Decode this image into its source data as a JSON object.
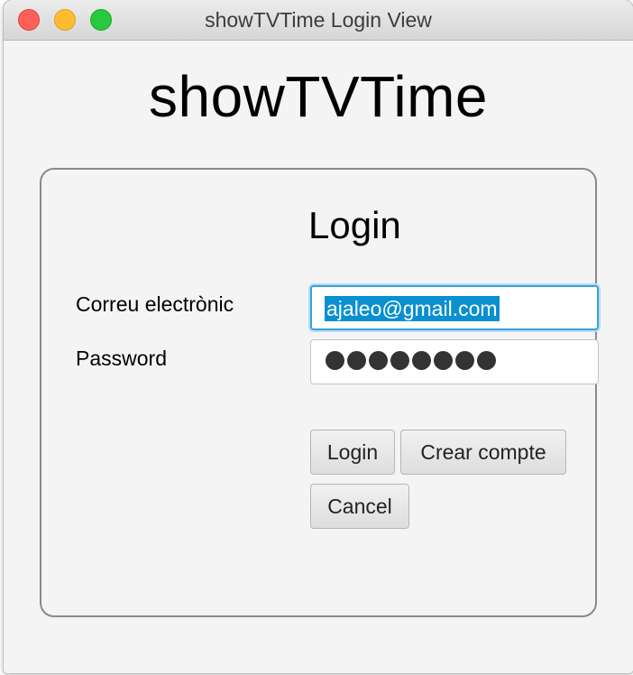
{
  "window": {
    "title": "showTVTime Login View"
  },
  "app": {
    "title": "showTVTime"
  },
  "login_form": {
    "heading": "Login",
    "email_label": "Correu electrònic",
    "email_value": "ajaleo@gmail.com",
    "password_label": "Password",
    "password_mask_count": 8,
    "buttons": {
      "login": "Login",
      "create_account": "Crear compte",
      "cancel": "Cancel"
    }
  },
  "colors": {
    "selection_highlight": "#0a8fd0",
    "focus_ring": "#3aa0dc",
    "close": "#fe5f57",
    "minimize": "#febc2e",
    "maximize": "#28c840"
  },
  "icons": [
    "close-window-button",
    "minimize-window-button",
    "maximize-window-button"
  ]
}
